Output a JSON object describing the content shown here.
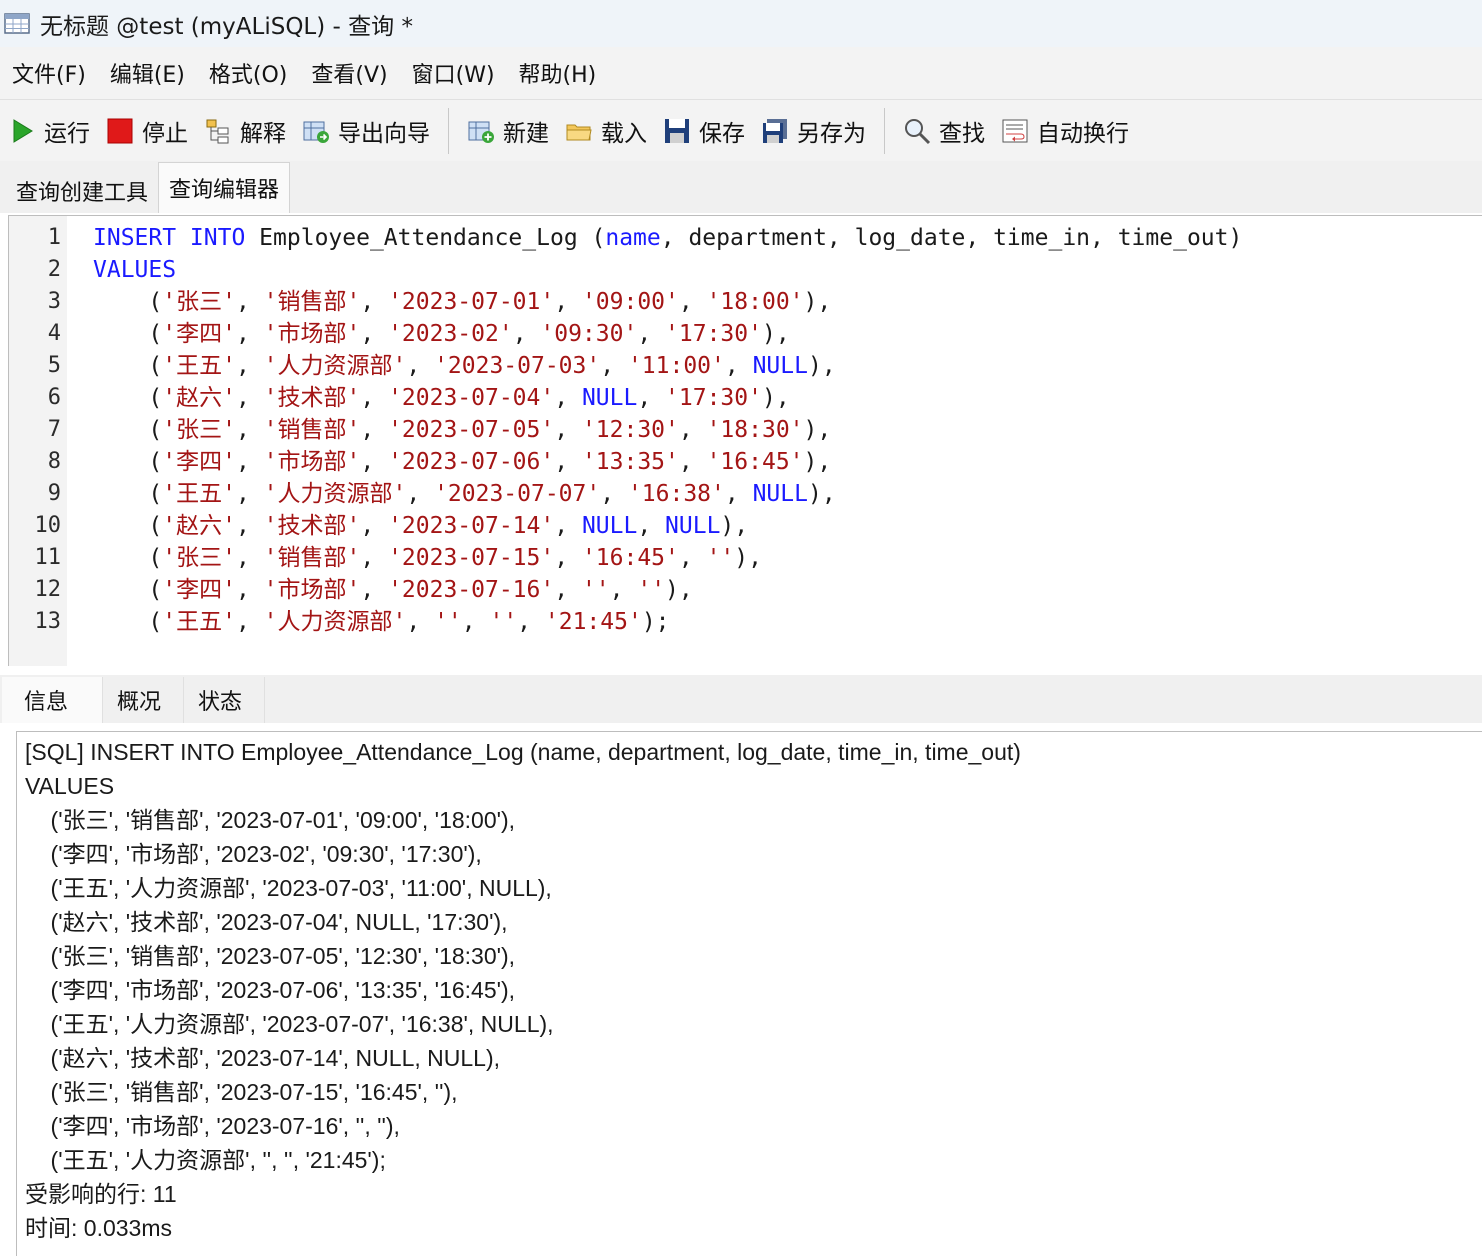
{
  "window": {
    "title": "无标题 @test (myALiSQL) - 查询 *"
  },
  "menu": [
    "文件(F)",
    "编辑(E)",
    "格式(O)",
    "查看(V)",
    "窗口(W)",
    "帮助(H)"
  ],
  "toolbar": {
    "run": "运行",
    "stop": "停止",
    "explain": "解释",
    "export_wizard": "导出向导",
    "new": "新建",
    "load": "载入",
    "save": "保存",
    "save_as": "另存为",
    "find": "查找",
    "word_wrap": "自动换行"
  },
  "tabs": [
    "查询创建工具",
    "查询编辑器"
  ],
  "editor": {
    "line_numbers": [
      "1",
      "2",
      "3",
      "4",
      "5",
      "6",
      "7",
      "8",
      "9",
      "10",
      "11",
      "12",
      "13"
    ],
    "lines": [
      [
        [
          "kw",
          "INSERT INTO"
        ],
        [
          "pl",
          " Employee_Attendance_Log ("
        ],
        [
          "kw",
          "name"
        ],
        [
          "pl",
          ", department, log_date, time_in, time_out)"
        ]
      ],
      [
        [
          "kw",
          "VALUES"
        ]
      ],
      [
        [
          "pl",
          "    ("
        ],
        [
          "str",
          "'张三'"
        ],
        [
          "pl",
          ", "
        ],
        [
          "str",
          "'销售部'"
        ],
        [
          "pl",
          ", "
        ],
        [
          "str",
          "'2023-07-01'"
        ],
        [
          "pl",
          ", "
        ],
        [
          "str",
          "'09:00'"
        ],
        [
          "pl",
          ", "
        ],
        [
          "str",
          "'18:00'"
        ],
        [
          "pl",
          "),"
        ]
      ],
      [
        [
          "pl",
          "    ("
        ],
        [
          "str",
          "'李四'"
        ],
        [
          "pl",
          ", "
        ],
        [
          "str",
          "'市场部'"
        ],
        [
          "pl",
          ", "
        ],
        [
          "str",
          "'2023-02'"
        ],
        [
          "pl",
          ", "
        ],
        [
          "str",
          "'09:30'"
        ],
        [
          "pl",
          ", "
        ],
        [
          "str",
          "'17:30'"
        ],
        [
          "pl",
          "),"
        ]
      ],
      [
        [
          "pl",
          "    ("
        ],
        [
          "str",
          "'王五'"
        ],
        [
          "pl",
          ", "
        ],
        [
          "str",
          "'人力资源部'"
        ],
        [
          "pl",
          ", "
        ],
        [
          "str",
          "'2023-07-03'"
        ],
        [
          "pl",
          ", "
        ],
        [
          "str",
          "'11:00'"
        ],
        [
          "pl",
          ", "
        ],
        [
          "kw",
          "NULL"
        ],
        [
          "pl",
          "),"
        ]
      ],
      [
        [
          "pl",
          "    ("
        ],
        [
          "str",
          "'赵六'"
        ],
        [
          "pl",
          ", "
        ],
        [
          "str",
          "'技术部'"
        ],
        [
          "pl",
          ", "
        ],
        [
          "str",
          "'2023-07-04'"
        ],
        [
          "pl",
          ", "
        ],
        [
          "kw",
          "NULL"
        ],
        [
          "pl",
          ", "
        ],
        [
          "str",
          "'17:30'"
        ],
        [
          "pl",
          "),"
        ]
      ],
      [
        [
          "pl",
          "    ("
        ],
        [
          "str",
          "'张三'"
        ],
        [
          "pl",
          ", "
        ],
        [
          "str",
          "'销售部'"
        ],
        [
          "pl",
          ", "
        ],
        [
          "str",
          "'2023-07-05'"
        ],
        [
          "pl",
          ", "
        ],
        [
          "str",
          "'12:30'"
        ],
        [
          "pl",
          ", "
        ],
        [
          "str",
          "'18:30'"
        ],
        [
          "pl",
          "),"
        ]
      ],
      [
        [
          "pl",
          "    ("
        ],
        [
          "str",
          "'李四'"
        ],
        [
          "pl",
          ", "
        ],
        [
          "str",
          "'市场部'"
        ],
        [
          "pl",
          ", "
        ],
        [
          "str",
          "'2023-07-06'"
        ],
        [
          "pl",
          ", "
        ],
        [
          "str",
          "'13:35'"
        ],
        [
          "pl",
          ", "
        ],
        [
          "str",
          "'16:45'"
        ],
        [
          "pl",
          "),"
        ]
      ],
      [
        [
          "pl",
          "    ("
        ],
        [
          "str",
          "'王五'"
        ],
        [
          "pl",
          ", "
        ],
        [
          "str",
          "'人力资源部'"
        ],
        [
          "pl",
          ", "
        ],
        [
          "str",
          "'2023-07-07'"
        ],
        [
          "pl",
          ", "
        ],
        [
          "str",
          "'16:38'"
        ],
        [
          "pl",
          ", "
        ],
        [
          "kw",
          "NULL"
        ],
        [
          "pl",
          "),"
        ]
      ],
      [
        [
          "pl",
          "    ("
        ],
        [
          "str",
          "'赵六'"
        ],
        [
          "pl",
          ", "
        ],
        [
          "str",
          "'技术部'"
        ],
        [
          "pl",
          ", "
        ],
        [
          "str",
          "'2023-07-14'"
        ],
        [
          "pl",
          ", "
        ],
        [
          "kw",
          "NULL"
        ],
        [
          "pl",
          ", "
        ],
        [
          "kw",
          "NULL"
        ],
        [
          "pl",
          "),"
        ]
      ],
      [
        [
          "pl",
          "    ("
        ],
        [
          "str",
          "'张三'"
        ],
        [
          "pl",
          ", "
        ],
        [
          "str",
          "'销售部'"
        ],
        [
          "pl",
          ", "
        ],
        [
          "str",
          "'2023-07-15'"
        ],
        [
          "pl",
          ", "
        ],
        [
          "str",
          "'16:45'"
        ],
        [
          "pl",
          ", "
        ],
        [
          "str",
          "''"
        ],
        [
          "pl",
          "),"
        ]
      ],
      [
        [
          "pl",
          "    ("
        ],
        [
          "str",
          "'李四'"
        ],
        [
          "pl",
          ", "
        ],
        [
          "str",
          "'市场部'"
        ],
        [
          "pl",
          ", "
        ],
        [
          "str",
          "'2023-07-16'"
        ],
        [
          "pl",
          ", "
        ],
        [
          "str",
          "''"
        ],
        [
          "pl",
          ", "
        ],
        [
          "str",
          "''"
        ],
        [
          "pl",
          "),"
        ]
      ],
      [
        [
          "pl",
          "    ("
        ],
        [
          "str",
          "'王五'"
        ],
        [
          "pl",
          ", "
        ],
        [
          "str",
          "'人力资源部'"
        ],
        [
          "pl",
          ", "
        ],
        [
          "str",
          "''"
        ],
        [
          "pl",
          ", "
        ],
        [
          "str",
          "''"
        ],
        [
          "pl",
          ", "
        ],
        [
          "str",
          "'21:45'"
        ],
        [
          "pl",
          ");"
        ]
      ]
    ]
  },
  "bottom_tabs": [
    "信息",
    "概况",
    "状态"
  ],
  "messages": [
    "[SQL] INSERT INTO Employee_Attendance_Log (name, department, log_date, time_in, time_out)",
    "VALUES",
    "    ('张三', '销售部', '2023-07-01', '09:00', '18:00'),",
    "    ('李四', '市场部', '2023-02', '09:30', '17:30'),",
    "    ('王五', '人力资源部', '2023-07-03', '11:00', NULL),",
    "    ('赵六', '技术部', '2023-07-04', NULL, '17:30'),",
    "    ('张三', '销售部', '2023-07-05', '12:30', '18:30'),",
    "    ('李四', '市场部', '2023-07-06', '13:35', '16:45'),",
    "    ('王五', '人力资源部', '2023-07-07', '16:38', NULL),",
    "    ('赵六', '技术部', '2023-07-14', NULL, NULL),",
    "    ('张三', '销售部', '2023-07-15', '16:45', ''),",
    "    ('李四', '市场部', '2023-07-16', '', ''),",
    "    ('王五', '人力资源部', '', '', '21:45');",
    "受影响的行: 11",
    "时间: 0.033ms"
  ]
}
